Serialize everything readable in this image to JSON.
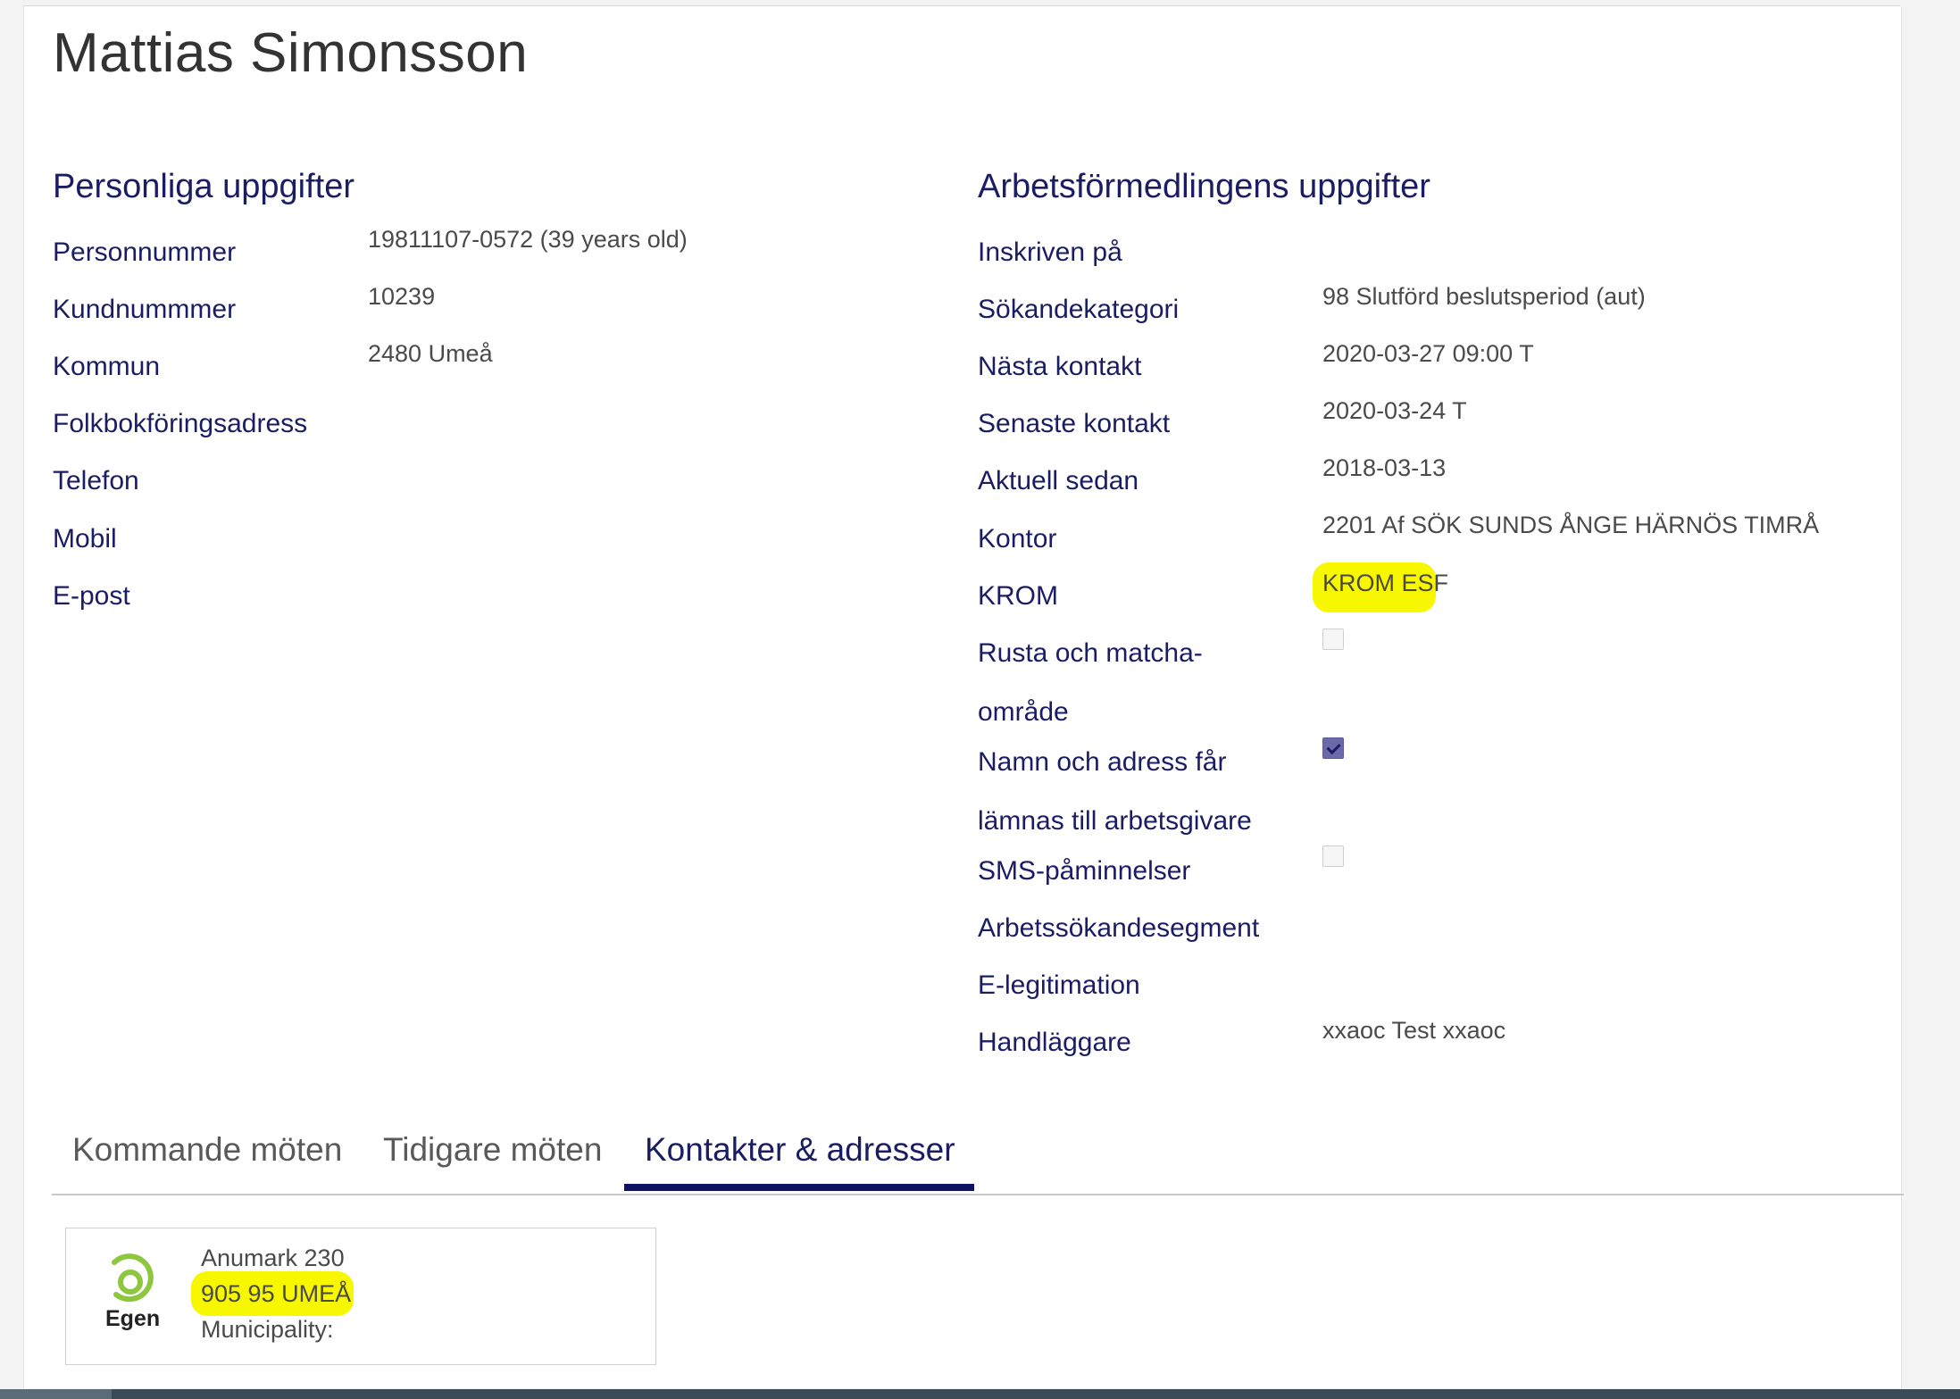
{
  "person": {
    "name": "Mattias Simonsson"
  },
  "personal": {
    "heading": "Personliga uppgifter",
    "fields": [
      {
        "label": "Personnummer",
        "value": "19811107-0572 (39 years old)"
      },
      {
        "label": "Kundnummmer",
        "value": "10239"
      },
      {
        "label": "Kommun",
        "value": "2480 Umeå"
      },
      {
        "label": "Folkbokföringsadress",
        "value": ""
      },
      {
        "label": "Telefon",
        "value": ""
      },
      {
        "label": "Mobil",
        "value": ""
      },
      {
        "label": "E-post",
        "value": ""
      }
    ]
  },
  "af": {
    "heading": "Arbetsförmedlingens uppgifter",
    "fields": [
      {
        "label": "Inskriven på",
        "value": ""
      },
      {
        "label": "Sökandekategori",
        "value": "98 Slutförd beslutsperiod (aut)"
      },
      {
        "label": "Nästa kontakt",
        "value": "2020-03-27 09:00 T"
      },
      {
        "label": "Senaste kontakt",
        "value": "2020-03-24 T"
      },
      {
        "label": "Aktuell sedan",
        "value": "2018-03-13"
      },
      {
        "label": "Kontor",
        "value": "2201 Af SÖK SUNDS ÅNGE HÄRNÖS TIMRÅ"
      },
      {
        "label": "KROM",
        "value": "KROM ESF"
      },
      {
        "label_line1": "Rusta och matcha-",
        "label_line2": "område",
        "checked": false
      },
      {
        "label_line1": "Namn och adress får",
        "label_line2": "lämnas till arbetsgivare",
        "checked": true
      },
      {
        "label": "SMS-påminnelser",
        "checked": false
      },
      {
        "label": "Arbetssökandesegment",
        "value": ""
      },
      {
        "label": "E-legitimation",
        "value": ""
      },
      {
        "label": "Handläggare",
        "value": "xxaoc Test xxaoc"
      }
    ]
  },
  "tabs": [
    {
      "label": "Kommande möten",
      "active": false
    },
    {
      "label": "Tidigare möten",
      "active": false
    },
    {
      "label": "Kontakter & adresser",
      "active": true
    }
  ],
  "address_card": {
    "logo_text": "Egen",
    "logo_color": "#8dc63f",
    "line1": "Anumark 230",
    "line2": "905 95 UMEÅ",
    "line3": "Municipality:"
  },
  "colors": {
    "label_navy": "#1b1d64",
    "highlight_yellow": "#f7f700",
    "tab_underline": "#0f1262"
  }
}
